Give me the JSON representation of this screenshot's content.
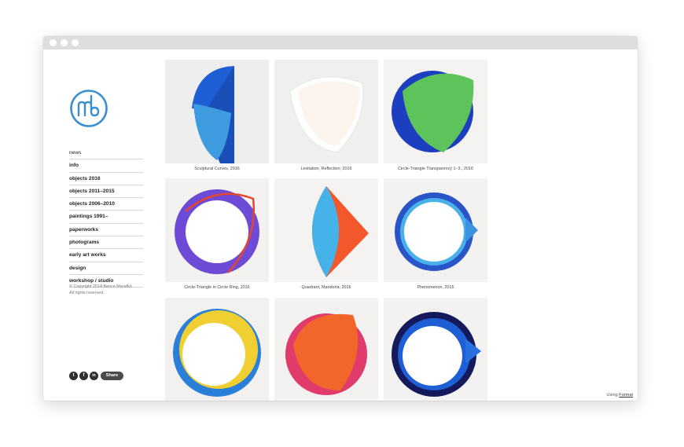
{
  "sidebar": {
    "logo_name": "mb-monogram",
    "nav": [
      {
        "label": "news"
      },
      {
        "label": "info"
      },
      {
        "label": "objects 2016"
      },
      {
        "label": "objects 2011–2015"
      },
      {
        "label": "objects 2006–2010"
      },
      {
        "label": "paintings 1991–"
      },
      {
        "label": "paperworks"
      },
      {
        "label": "photograms"
      },
      {
        "label": "early art works"
      },
      {
        "label": "design"
      },
      {
        "label": "workshop / studio"
      }
    ],
    "copyright_line1": "© Copyright 2014 Bence Marafkó.",
    "copyright_line2": "All rights reserved.",
    "social": {
      "twitter_icon": "twitter-icon",
      "facebook_icon": "facebook-icon",
      "linkedin_icon": "linkedin-icon",
      "twitter_glyph": "t",
      "facebook_glyph": "f",
      "linkedin_glyph": "in",
      "share_label": "Share"
    }
  },
  "gallery": [
    {
      "caption": "Sculptural Curves, 2016"
    },
    {
      "caption": "Levitation, Reflection; 2016"
    },
    {
      "caption": "Circle-Triangle Transparency 1–3., 2016"
    },
    {
      "caption": "Circle-Triangle in Circle Ring, 2016"
    },
    {
      "caption": "Quadrant, Mandorla; 2016"
    },
    {
      "caption": "Phenomenon, 2015"
    },
    {
      "caption": ""
    },
    {
      "caption": ""
    },
    {
      "caption": ""
    }
  ],
  "footer": {
    "using_label": "Using",
    "format_link": "Format"
  },
  "colors": {
    "titlebar": "#dedede",
    "logo_blue": "#3a8fd3",
    "artwork_blue": "#1f5fd6",
    "artwork_green": "#5cc45b",
    "artwork_orange": "#f2582c",
    "artwork_yellow": "#f0cf33"
  }
}
